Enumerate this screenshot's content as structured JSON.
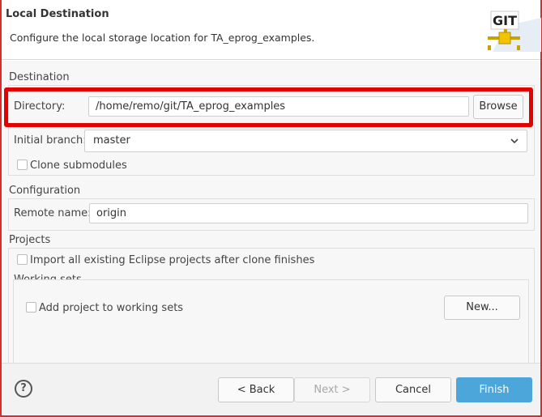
{
  "header": {
    "title": "Local Destination",
    "description": "Configure the local storage location for TA_eprog_examples.",
    "logo_text": "GIT"
  },
  "destination": {
    "group_title": "Destination",
    "directory_label": "Directory:",
    "directory_value": "/home/remo/git/TA_eprog_examples",
    "browse_label": "Browse",
    "initial_branch_label": "Initial branch:",
    "initial_branch_value": "master",
    "clone_submodules_label": "Clone submodules"
  },
  "configuration": {
    "group_title": "Configuration",
    "remote_name_label": "Remote name:",
    "remote_name_value": "origin"
  },
  "projects": {
    "group_title": "Projects",
    "import_label": "Import all existing Eclipse projects after clone finishes",
    "working_sets_title": "Working sets",
    "add_to_working_sets_label": "Add project to working sets",
    "new_button_label": "New..."
  },
  "footer": {
    "back_label": "< Back",
    "next_label": "Next >",
    "cancel_label": "Cancel",
    "finish_label": "Finish"
  },
  "colors": {
    "highlight": "#e30000",
    "finish_button": "#4da6d9",
    "frame_border": "#d32f2f"
  }
}
